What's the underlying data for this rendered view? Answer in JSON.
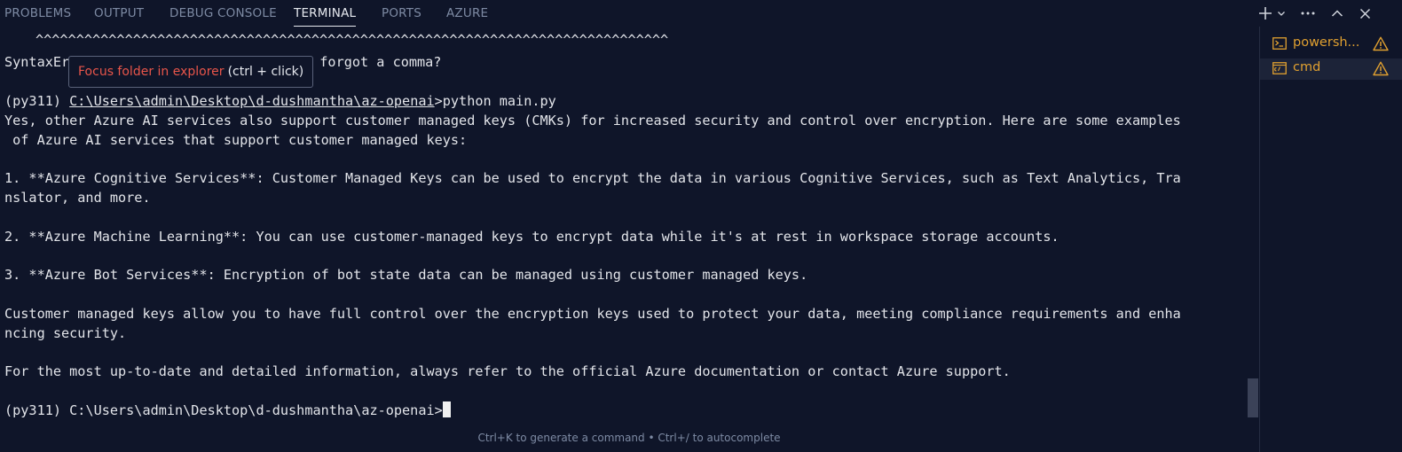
{
  "tabs": [
    "PROBLEMS",
    "OUTPUT",
    "DEBUG CONSOLE",
    "TERMINAL",
    "PORTS",
    "AZURE"
  ],
  "active_tab": "TERMINAL",
  "toolbar": {
    "new_terminal_icon": "plus-icon",
    "launch_profile_icon": "chevron-down-icon",
    "more_actions_icon": "ellipsis-icon",
    "maximize_icon": "chevron-up-icon",
    "close_icon": "close-icon"
  },
  "terminal": {
    "carets": "^^^^^^^^^^^^^^^^^^^^^^^^^^^^^^^^^^^^^^^^^^^^^^^^^^^^^^^^^^^^^^^^^^^^^^^^^^^^^^",
    "error_line_start": "SyntaxEr",
    "error_line_end": "u forgot a comma?",
    "prompt_env": "(py311) ",
    "prompt_path": "C:\\Users\\admin\\Desktop\\d-dushmantha\\az-openai",
    "command": ">python main.py",
    "output": [
      "Yes, other Azure AI services also support customer managed keys (CMKs) for increased security and control over encryption. Here are some examples",
      " of Azure AI services that support customer managed keys:",
      "1. **Azure Cognitive Services**: Customer Managed Keys can be used to encrypt the data in various Cognitive Services, such as Text Analytics, Tra",
      "nslator, and more.",
      "2. **Azure Machine Learning**: You can use customer-managed keys to encrypt data while it's at rest in workspace storage accounts.",
      "3. **Azure Bot Services**: Encryption of bot state data can be managed using customer managed keys.",
      "Customer managed keys allow you to have full control over the encryption keys used to protect your data, meeting compliance requirements and enha",
      "ncing security.",
      "For the most up-to-date and detailed information, always refer to the official Azure documentation or contact Azure support."
    ],
    "final_prompt": "(py311) C:\\Users\\admin\\Desktop\\d-dushmantha\\az-openai>"
  },
  "tooltip": {
    "link_text": "Focus folder in explorer",
    "hint_text": "(ctrl + click)"
  },
  "hint": "Ctrl+K to generate a command • Ctrl+/ to autocomplete",
  "terminals": [
    {
      "label": "powersh...",
      "icon": "powershell-icon",
      "warning": "warning-icon"
    },
    {
      "label": "cmd",
      "icon": "cmd-icon",
      "warning": "warning-icon"
    }
  ],
  "colors": {
    "background": "#0f1529",
    "warning": "#e0a030",
    "tooltip_link": "#e8554a"
  }
}
